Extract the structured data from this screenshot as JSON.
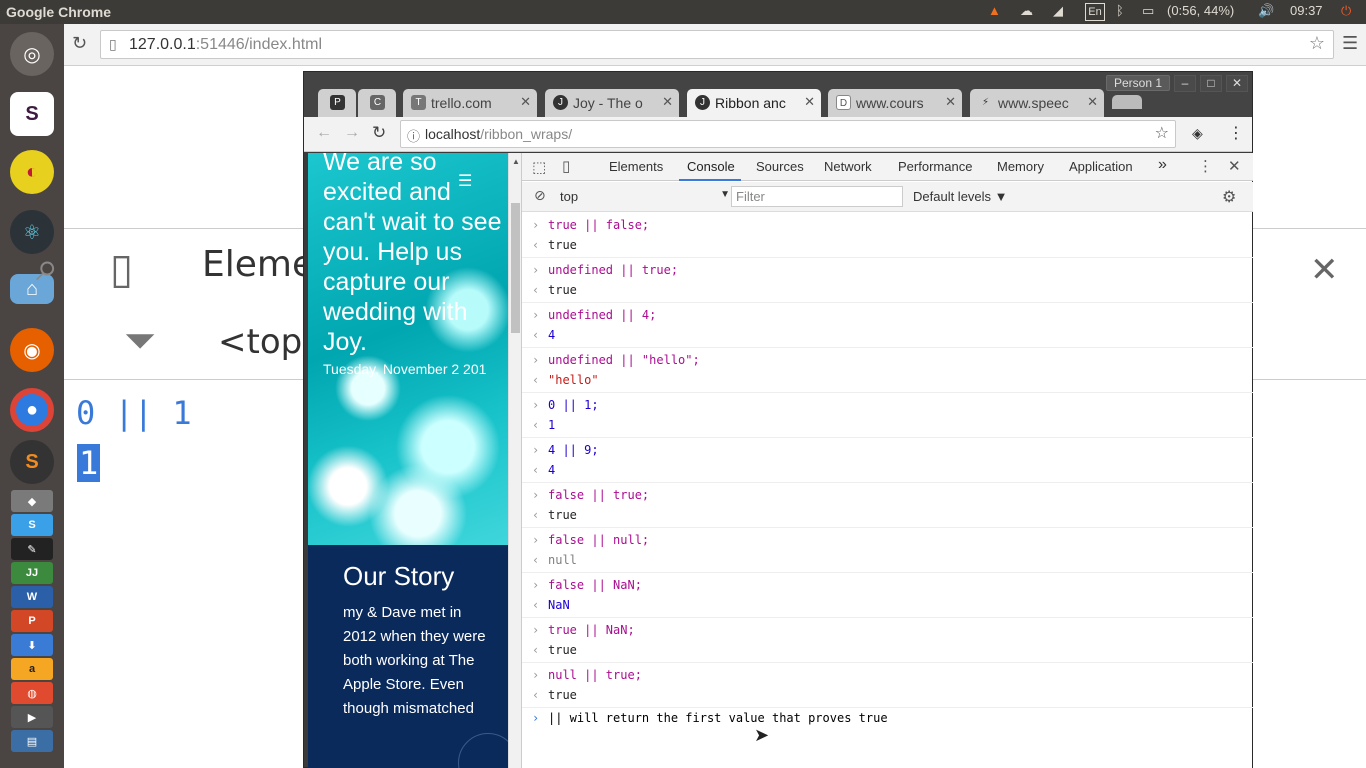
{
  "topbar": {
    "app_title": "Google Chrome",
    "battery": "(0:56, 44%)",
    "keyboard": "En",
    "time": "09:37"
  },
  "launcher": {
    "items": [
      "ubuntu-dash",
      "slack",
      "app-red-yellow",
      "atom",
      "home-folder",
      "firefox",
      "chrome",
      "sublime",
      "app-misc"
    ]
  },
  "bg_chrome": {
    "url_host": "127.0.0.1",
    "url_port": ":51446",
    "url_path": "/index.html",
    "zoom_elements_label": "Eleme",
    "zoom_context_label": "<top",
    "zoom_input": "0 || 1",
    "zoom_output": "1"
  },
  "fg_window": {
    "person": "Person 1",
    "tabs": [
      {
        "label": "",
        "favicon": "P"
      },
      {
        "label": "",
        "favicon": "C"
      },
      {
        "label": "trello.com",
        "favicon": "T"
      },
      {
        "label": "Joy - The o",
        "favicon": "J"
      },
      {
        "label": "Ribbon anc",
        "favicon": "J"
      },
      {
        "label": "www.cours",
        "favicon": "D"
      },
      {
        "label": "www.speec",
        "favicon": "⚡"
      }
    ],
    "url_host": "localhost",
    "url_path": "/ribbon_wraps/"
  },
  "page": {
    "hero_text": "We are so excited and can't wait to see you. Help us capture our wedding with Joy.",
    "hero_date": "Tuesday, November 2 201",
    "story_title": "Our Story",
    "story_text": "my & Dave met in 2012 when they were both working at The Apple Store. Even though mismatched"
  },
  "devtools": {
    "tabs": [
      "Elements",
      "Console",
      "Sources",
      "Network",
      "Performance",
      "Memory",
      "Application"
    ],
    "active_tab": "Console",
    "more": "»",
    "context": "top",
    "filter_placeholder": "Filter",
    "levels": "Default levels ▼",
    "entries": [
      {
        "input": "true || false;",
        "output": "true"
      },
      {
        "input": "undefined || true;",
        "output": "true"
      },
      {
        "input": "undefined || 4;",
        "output": "4"
      },
      {
        "input": "undefined || \"hello\";",
        "output": "\"hello\""
      },
      {
        "input": "0 || 1;",
        "output": "1"
      },
      {
        "input": "4 || 9;",
        "output": "4"
      },
      {
        "input": "false || true;",
        "output": "true"
      },
      {
        "input": "false || null;",
        "output": "null"
      },
      {
        "input": "false || NaN;",
        "output": "NaN"
      },
      {
        "input": "true || NaN;",
        "output": "true"
      },
      {
        "input": "null || true;",
        "output": "true"
      }
    ],
    "prompt_text": "|| will return the first value that proves true"
  }
}
